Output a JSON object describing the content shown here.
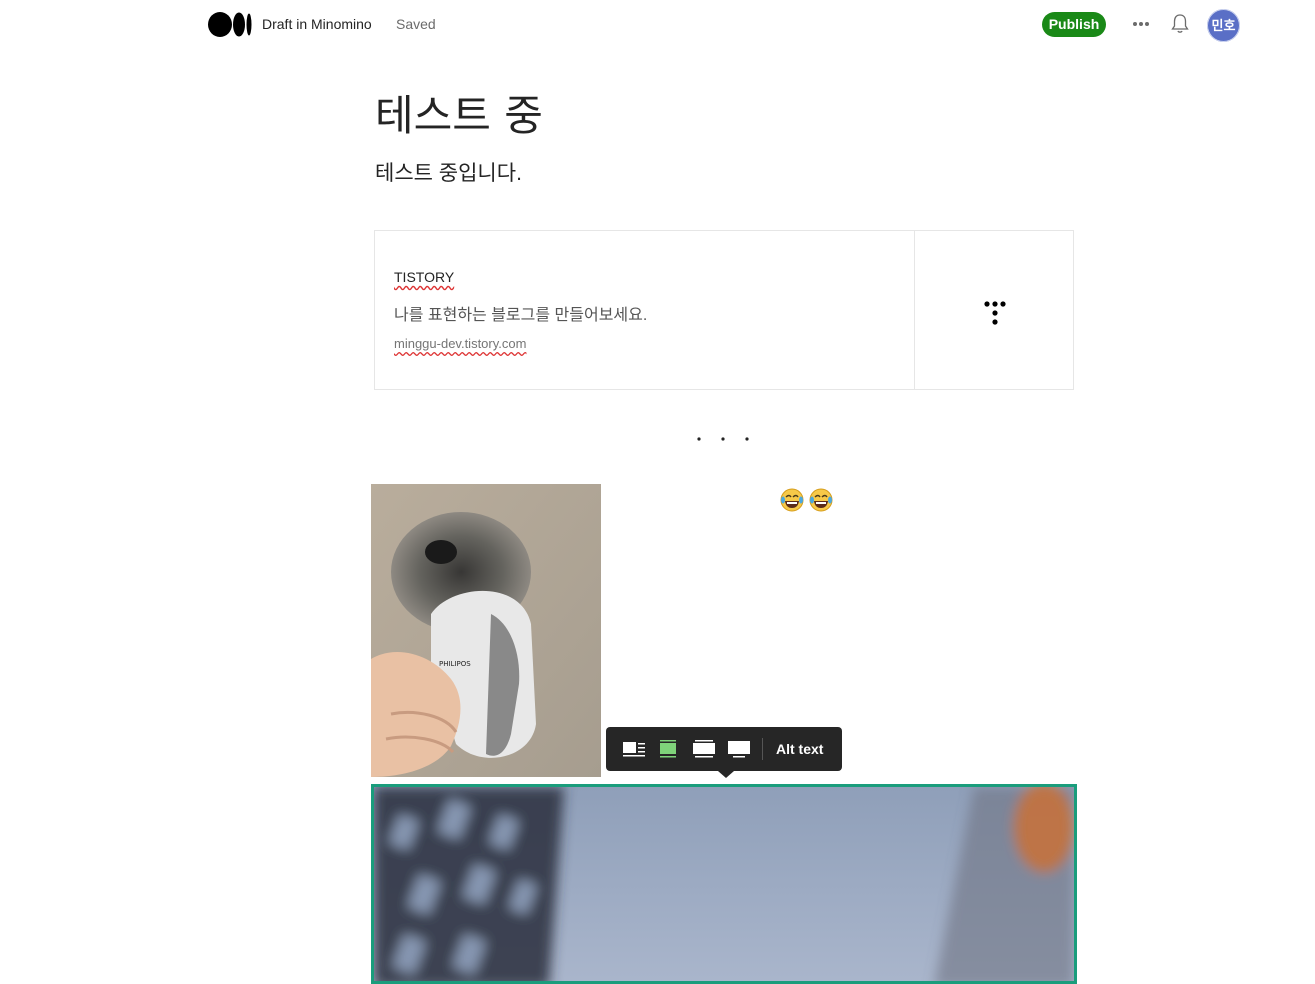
{
  "header": {
    "brand_text": "Draft in Minomino",
    "status_text": "Saved",
    "publish_label": "Publish",
    "avatar_text": "민호",
    "icons": [
      "medium-logo",
      "more-icon",
      "bell-icon"
    ]
  },
  "post": {
    "title": "테스트 중",
    "subtitle": "테스트 중입니다."
  },
  "embed": {
    "title": "TISTORY",
    "description": "나를 표현하는 블로그를 만들어보세요.",
    "url": "minggu-dev.tistory.com"
  },
  "emoji": "😂😂",
  "toolbar": {
    "alt_text_label": "Alt text",
    "buttons": [
      "inset-left-icon",
      "inset-center-icon",
      "outset-icon",
      "full-width-icon"
    ],
    "active_button": "inset-center-icon"
  },
  "colors": {
    "publish": "#1a8917",
    "selection_border": "#1a9d7c",
    "toolbar_bg": "#262626",
    "avatar": "#5a6fc6"
  }
}
